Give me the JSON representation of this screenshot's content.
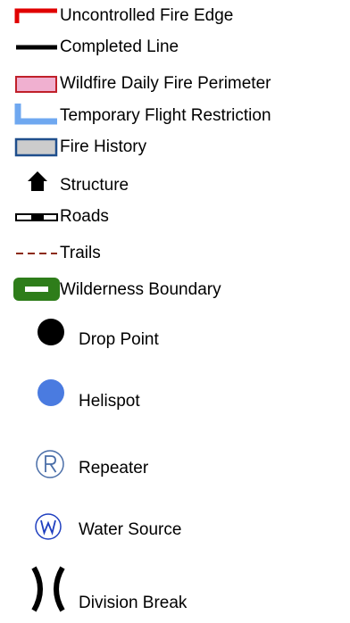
{
  "legend": {
    "items": [
      {
        "label": "Uncontrolled Fire Edge",
        "icon": "uncontrolled-fire-edge-icon",
        "color": "#e00000"
      },
      {
        "label": "Completed Line",
        "icon": "completed-line-icon",
        "color": "#000000"
      },
      {
        "label": "Wildfire Daily Fire Perimeter",
        "icon": "fire-perimeter-icon",
        "color": "#f0b0d0",
        "stroke": "#c0202a"
      },
      {
        "label": "Temporary Flight Restriction",
        "icon": "flight-restriction-icon",
        "color": "#6fa8f0"
      },
      {
        "label": "Fire History",
        "icon": "fire-history-icon",
        "color": "#cccccc",
        "stroke": "#1f4e8c"
      },
      {
        "label": "Structure",
        "icon": "structure-icon",
        "color": "#000000"
      },
      {
        "label": "Roads",
        "icon": "roads-icon",
        "color": "#000000"
      },
      {
        "label": "Trails",
        "icon": "trails-icon",
        "color": "#8b2a10"
      },
      {
        "label": "Wilderness Boundary",
        "icon": "wilderness-boundary-icon",
        "color": "#2e7d1a"
      },
      {
        "label": "Drop Point",
        "icon": "drop-point-icon",
        "color": "#000000"
      },
      {
        "label": "Helispot",
        "icon": "helispot-icon",
        "color": "#4a7be0"
      },
      {
        "label": "Repeater",
        "icon": "repeater-icon",
        "color": "#1f4e8c"
      },
      {
        "label": "Water Source",
        "icon": "water-source-icon",
        "color": "#2040c0"
      },
      {
        "label": "Division Break",
        "icon": "division-break-icon",
        "color": "#000000"
      }
    ]
  }
}
